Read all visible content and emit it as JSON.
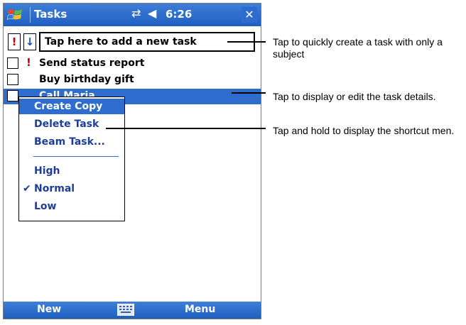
{
  "titlebar": {
    "title": "Tasks",
    "clock": "6:26",
    "icons": [
      "windows-start-icon",
      "connectivity-icon",
      "volume-icon",
      "close-icon"
    ],
    "close_label": "✕"
  },
  "entry_bar": {
    "priority_high_label": "!",
    "priority_low_label": "↓",
    "placeholder": "Tap here to add a new task"
  },
  "tasks": [
    {
      "subject": "Send status report",
      "priority": "high",
      "priority_mark": "!"
    },
    {
      "subject": "Buy birthday gift",
      "priority": "normal"
    },
    {
      "subject": "Call Maria",
      "priority": "normal",
      "selected": true
    }
  ],
  "context_menu": {
    "items": [
      {
        "label": "Create Copy",
        "active": true
      },
      {
        "label": "Delete Task"
      },
      {
        "label": "Beam Task..."
      },
      {
        "label": "High"
      },
      {
        "label": "Normal",
        "checked": true
      },
      {
        "label": "Low"
      }
    ]
  },
  "menubar": {
    "left_softkey": "New",
    "right_softkey": "Menu",
    "keyboard_icon": "keyboard-icon"
  },
  "callouts": [
    "Tap to quickly create a task with only a subject",
    "Tap to display or edit the task details.",
    "Tap and hold to display the shortcut men."
  ],
  "colors": {
    "title_bar": "#2f6cd0",
    "selection": "#2f6cd0",
    "menu_text": "#1d3d9a",
    "high_priority": "#c00000"
  }
}
